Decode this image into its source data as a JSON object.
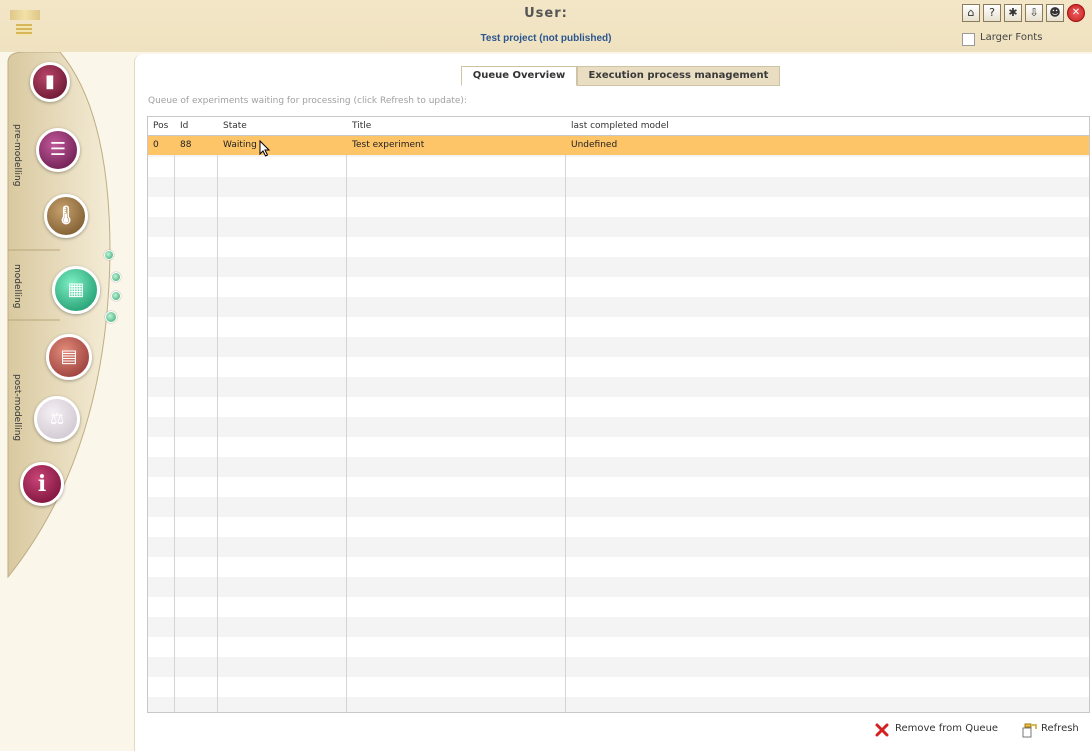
{
  "header": {
    "user_label": "User:",
    "project_label": "Test project (not published)",
    "toolbar_icons": [
      "home-icon",
      "help-icon",
      "bug-icon",
      "upload-icon",
      "users-icon",
      "close-icon"
    ],
    "larger_fonts_label": "Larger Fonts",
    "larger_fonts_checked": false
  },
  "sidebar": {
    "sections": [
      {
        "label": "pre-modelling"
      },
      {
        "label": "modelling"
      },
      {
        "label": "post-modelling"
      }
    ],
    "items": [
      {
        "icon": "clipboard-icon",
        "color": "#7a1b39"
      },
      {
        "icon": "database-icon",
        "color": "#7a1b4e"
      },
      {
        "icon": "thermometer-icon",
        "color": "#8a6a3e"
      },
      {
        "icon": "calculator-icon",
        "color": "#1f9a73"
      },
      {
        "icon": "chart-icon",
        "color": "#b24a4a"
      },
      {
        "icon": "scales-icon",
        "color": "#d4cfd4"
      },
      {
        "icon": "info-icon",
        "color": "#8a1240"
      }
    ]
  },
  "tabs": [
    {
      "label": "Queue Overview",
      "active": true
    },
    {
      "label": "Execution process management",
      "active": false
    }
  ],
  "queue": {
    "info": "Queue of experiments waiting for processing (click Refresh to update):",
    "columns": [
      "Pos",
      "Id",
      "State",
      "Title",
      "last completed model"
    ],
    "rows": [
      {
        "pos": "0",
        "id": "88",
        "state": "Waiting",
        "title": "Test experiment",
        "last_model": "Undefined"
      }
    ]
  },
  "actions": {
    "remove_label": "Remove from Queue",
    "refresh_label": "Refresh"
  },
  "colors": {
    "selected_row": "#fec468",
    "header_bg": "#f3e6c7",
    "project_text": "#2b5690"
  }
}
